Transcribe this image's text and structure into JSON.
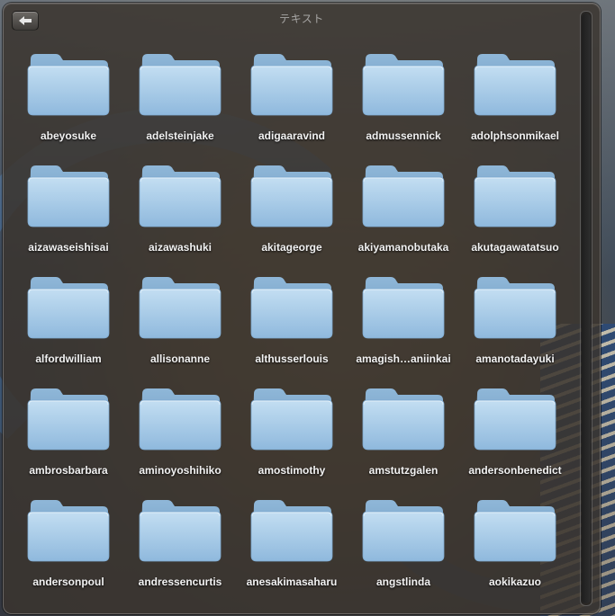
{
  "panel": {
    "title": "テキスト",
    "back_icon": "back-arrow-icon",
    "folder_icon": "folder-icon",
    "folder_color": "#a9cde8"
  },
  "folders": [
    "abeyosuke",
    "adelsteinjake",
    "adigaaravind",
    "admussennick",
    "adolphsonmikael",
    "aizawaseishisai",
    "aizawashuki",
    "akitageorge",
    "akiyamanobutaka",
    "akutagawatatsuo",
    "alfordwilliam",
    "allisonanne",
    "althusserlouis",
    "amagish…aniinkai",
    "amanotadayuki",
    "ambrosbarbara",
    "aminoyoshihiko",
    "amostimothy",
    "amstutzgalen",
    "andersonbenedict",
    "andersonpoul",
    "andressencurtis",
    "anesakimasaharu",
    "angstlinda",
    "aokikazuo"
  ]
}
